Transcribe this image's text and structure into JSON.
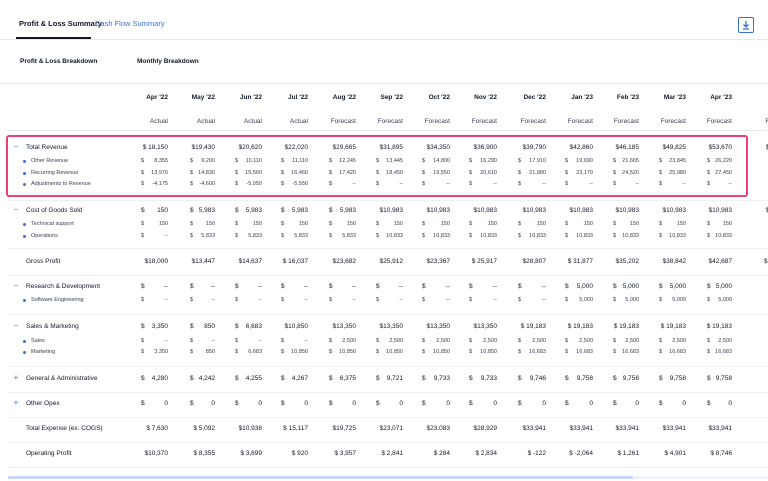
{
  "tabs": [
    {
      "label": "Profit & Loss Summary",
      "active": true
    },
    {
      "label": "Cash Flow Summary",
      "active": false
    }
  ],
  "toolbar": {
    "export_icon": "download-icon"
  },
  "breakdown": {
    "left_label": "Profit & Loss Breakdown",
    "right_label": "Monthly Breakdown"
  },
  "columns": [
    {
      "month": "Apr '22",
      "type": "Actual"
    },
    {
      "month": "May '22",
      "type": "Actual"
    },
    {
      "month": "Jun '22",
      "type": "Actual"
    },
    {
      "month": "Jul '22",
      "type": "Actual"
    },
    {
      "month": "Aug '22",
      "type": "Forecast"
    },
    {
      "month": "Sep '22",
      "type": "Forecast"
    },
    {
      "month": "Oct '22",
      "type": "Forecast"
    },
    {
      "month": "Nov '22",
      "type": "Forecast"
    },
    {
      "month": "Dec '22",
      "type": "Forecast"
    },
    {
      "month": "Jan '23",
      "type": "Forecast"
    },
    {
      "month": "Feb '23",
      "type": "Forecast"
    },
    {
      "month": "Mar '23",
      "type": "Forecast"
    },
    {
      "month": "Apr '23",
      "type": "Forecast"
    },
    {
      "month": "M",
      "type": "Fo"
    }
  ],
  "rows": [
    {
      "kind": "main",
      "toggle": "−",
      "label": "Total Revenue",
      "values": [
        "$ 18,150",
        "$19,430",
        "$20,620",
        "$22,020",
        "$29,665",
        "$31,895",
        "$34,350",
        "$36,900",
        "$39,790",
        "$42,860",
        "$46,185",
        "$49,825",
        "$53,670",
        "$5"
      ]
    },
    {
      "kind": "sub",
      "label": "Other Revenue",
      "dollar": "$",
      "values": [
        "8,355",
        "9,200",
        "10,110",
        "11,110",
        "12,245",
        "13,445",
        "14,800",
        "16,290",
        "17,910",
        "19,690",
        "21,665",
        "23,845",
        "26,220",
        ""
      ]
    },
    {
      "kind": "sub",
      "label": "Recurring Revenue",
      "dollar": "$",
      "values": [
        "13,970",
        "14,830",
        "15,560",
        "16,460",
        "17,420",
        "18,450",
        "19,550",
        "20,610",
        "21,880",
        "23,170",
        "24,520",
        "25,980",
        "27,450",
        ""
      ]
    },
    {
      "kind": "sub",
      "label": "Adjustments to Revenue",
      "dollar": "$",
      "values": [
        "-4,175",
        "-4,600",
        "-5,050",
        "-5,550",
        "--",
        "--",
        "--",
        "--",
        "--",
        "--",
        "--",
        "--",
        "--",
        ""
      ]
    },
    {
      "kind": "main",
      "toggle": "−",
      "label": "Cost of Goods Sold",
      "dollar": "$",
      "values": [
        "150",
        "5,983",
        "5,983",
        "5,983",
        "5,983",
        "$10,983",
        "$10,983",
        "$10,983",
        "$10,983",
        "$10,983",
        "$10,983",
        "$10,983",
        "$10,983",
        "$1"
      ]
    },
    {
      "kind": "sub",
      "label": "Technical support",
      "dollar": "$",
      "values": [
        "150",
        "150",
        "150",
        "150",
        "150",
        "150",
        "150",
        "150",
        "150",
        "150",
        "150",
        "150",
        "150",
        ""
      ]
    },
    {
      "kind": "sub",
      "label": "Operations",
      "dollar": "$",
      "values": [
        "--",
        "5,833",
        "5,833",
        "5,833",
        "5,833",
        "10,833",
        "10,833",
        "10,833",
        "10,833",
        "10,833",
        "10,833",
        "10,833",
        "10,833",
        ""
      ]
    },
    {
      "kind": "main",
      "label": "Gross Profit",
      "values": [
        "$18,000",
        "$13,447",
        "$14,637",
        "$ 16,037",
        "$23,682",
        "$25,912",
        "$23,367",
        "$ 25,917",
        "$28,807",
        "$ 31,877",
        "$35,202",
        "$38,842",
        "$42,687",
        "$ 4"
      ]
    },
    {
      "kind": "main",
      "toggle": "−",
      "label": "Research & Development",
      "dollar": "$",
      "values": [
        "--",
        "--",
        "--",
        "--",
        "--",
        "--",
        "--",
        "--",
        "--",
        "5,000",
        "5,000",
        "5,000",
        "5,000",
        "$"
      ]
    },
    {
      "kind": "sub",
      "label": "Software Engineering",
      "dollar": "$",
      "values": [
        "--",
        "--",
        "--",
        "--",
        "--",
        "--",
        "--",
        "--",
        "--",
        "5,000",
        "5,000",
        "5,000",
        "5,000",
        ""
      ]
    },
    {
      "kind": "main",
      "toggle": "−",
      "label": "Sales & Marketing",
      "dollar": "$",
      "values": [
        "3,350",
        "850",
        "6,683",
        "$10,850",
        "$13,350",
        "$13,350",
        "$13,350",
        "$13,350",
        "$ 19,183",
        "$ 19,183",
        "$ 19,183",
        "$ 19,183",
        "$ 19,183",
        "$"
      ]
    },
    {
      "kind": "sub",
      "label": "Sales",
      "dollar": "$",
      "values": [
        "--",
        "--",
        "--",
        "--",
        "2,500",
        "2,500",
        "2,500",
        "2,500",
        "2,500",
        "2,500",
        "2,500",
        "2,500",
        "2,500",
        ""
      ]
    },
    {
      "kind": "sub",
      "label": "Marketing",
      "dollar": "$",
      "values": [
        "3,350",
        "850",
        "6,683",
        "10,850",
        "10,850",
        "10,850",
        "10,850",
        "10,850",
        "16,683",
        "16,683",
        "16,683",
        "16,683",
        "16,683",
        ""
      ]
    },
    {
      "kind": "main",
      "toggle": "+",
      "label": "General & Administrative",
      "dollar": "$",
      "values": [
        "4,280",
        "4,242",
        "4,255",
        "4,267",
        "6,375",
        "9,721",
        "9,733",
        "9,733",
        "9,746",
        "9,758",
        "9,758",
        "9,758",
        "9,758",
        "$"
      ]
    },
    {
      "kind": "main",
      "toggle": "+",
      "label": "Other Opex",
      "dollar": "$",
      "values": [
        "0",
        "0",
        "0",
        "0",
        "0",
        "0",
        "0",
        "0",
        "0",
        "0",
        "0",
        "0",
        "0",
        "$"
      ]
    },
    {
      "kind": "main",
      "label": "Total Expense (ex. COGS)",
      "values": [
        "$ 7,630",
        "$ 5,092",
        "$10,938",
        "$ 15,117",
        "$19,725",
        "$23,071",
        "$23,083",
        "$28,929",
        "$33,941",
        "$33,941",
        "$33,941",
        "$33,941",
        "$33,941",
        "$"
      ]
    },
    {
      "kind": "main",
      "label": "Operating Profit",
      "values": [
        "$10,370",
        "$ 8,355",
        "$ 3,699",
        "$ 920",
        "$ 3,957",
        "$ 2,841",
        "$ 284",
        "$ 2,834",
        "$ -122",
        "$ -2,064",
        "$ 1,261",
        "$ 4,901",
        "$ 8,746",
        "$"
      ]
    }
  ],
  "colors": {
    "accent": "#3b6fd8",
    "highlight": "#ec4178"
  }
}
